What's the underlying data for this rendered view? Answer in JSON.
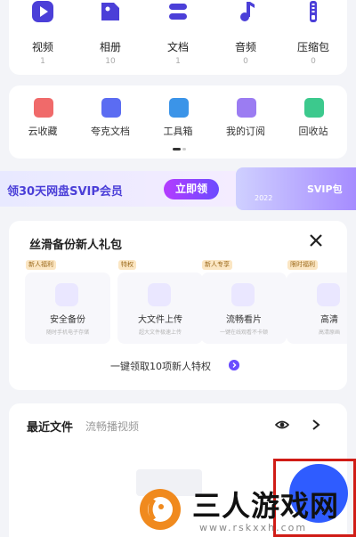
{
  "categories": [
    {
      "label": "视频",
      "count": "1",
      "icon": "play-icon",
      "color": "#4b3fd8"
    },
    {
      "label": "相册",
      "count": "10",
      "icon": "photo-icon",
      "color": "#4b3fd8"
    },
    {
      "label": "文档",
      "count": "1",
      "icon": "document-icon",
      "color": "#4b3fd8"
    },
    {
      "label": "音频",
      "count": "0",
      "icon": "music-note-icon",
      "color": "#4b3fd8"
    },
    {
      "label": "压缩包",
      "count": "0",
      "icon": "zip-icon",
      "color": "#4b3fd8"
    }
  ],
  "tools": [
    {
      "label": "云收藏",
      "icon": "favorite-folder-icon",
      "color": "#f06a6a"
    },
    {
      "label": "夸克文档",
      "icon": "quark-doc-icon",
      "color": "#5b6cf2"
    },
    {
      "label": "工具箱",
      "icon": "toolbox-icon",
      "color": "#3b94e8"
    },
    {
      "label": "我的订阅",
      "icon": "subscription-icon",
      "color": "#9b7cf2"
    },
    {
      "label": "回收站",
      "icon": "trash-icon",
      "color": "#3cc98d"
    }
  ],
  "banner": {
    "text": "领30天网盘SVIP会员",
    "button": "立即领",
    "badge": "SVIP包",
    "year": "2022"
  },
  "gift": {
    "title": "丝滑备份新人礼包",
    "close_icon": "close-icon",
    "items": [
      {
        "tag": "新人福利",
        "label": "安全备份",
        "sub": "随时手机电子存储",
        "icon": "backup-icon"
      },
      {
        "tag": "特权",
        "label": "大文件上传",
        "sub": "超大文件极速上传",
        "icon": "upload-icon"
      },
      {
        "tag": "新人专享",
        "label": "流畅看片",
        "sub": "一键在线观看不卡顿",
        "icon": "video-player-icon"
      },
      {
        "tag": "限时福利",
        "label": "高清",
        "sub": "高清原画",
        "icon": "hd-icon"
      }
    ],
    "claim": "一键领取10项新人特权"
  },
  "recent": {
    "title": "最近文件",
    "subtitle": "流畅播视频"
  },
  "watermark": {
    "text": "三人游戏网",
    "url": "www.rskxxh.com"
  },
  "colors": {
    "accent": "#4b3fd8",
    "purple_button": "#8c42ff",
    "fab_blue": "#2f5cff",
    "highlight_red": "#d01c16"
  }
}
